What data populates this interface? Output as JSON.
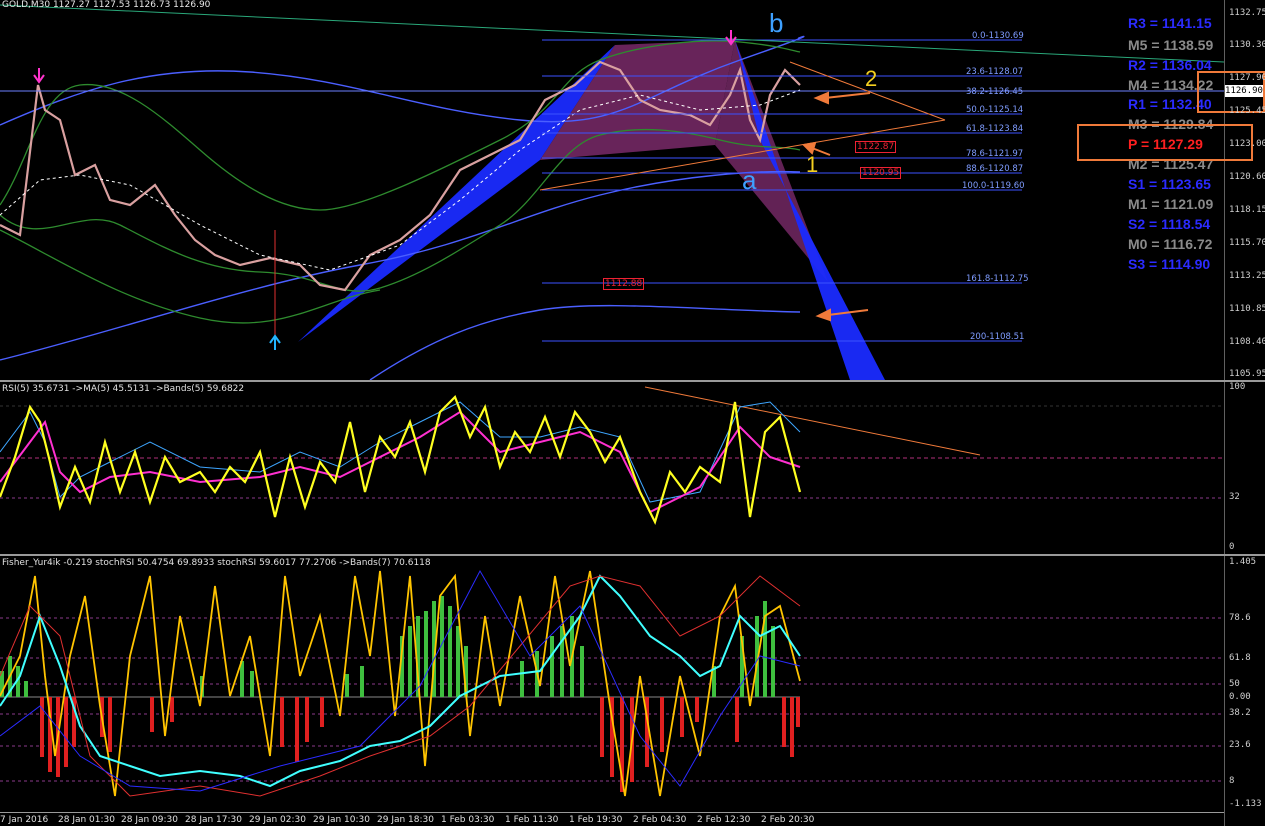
{
  "header": {
    "symbol_line": "GOLD,M30  1127.27 1127.53 1126.73 1126.90"
  },
  "price_scale": {
    "labels": [
      "1132.75",
      "1130.30",
      "1127.90",
      "1125.45",
      "1123.00",
      "1120.60",
      "1118.15",
      "1115.70",
      "1113.25",
      "1110.85",
      "1108.40",
      "1105.95"
    ],
    "current": "1126.90"
  },
  "fibonacci": {
    "levels": [
      "0.0-1130.69",
      "23.6-1128.07",
      "38.2-1126.45",
      "50.0-1125.14",
      "61.8-1123.84",
      "78.6-1121.97",
      "88.6-1120.87",
      "100.0-1119.60",
      "161.8-1112.75",
      "200-1108.51"
    ]
  },
  "price_boxes": [
    "1122.87",
    "1120.95",
    "1112.88"
  ],
  "wave_labels": {
    "a": "a",
    "b": "b",
    "one": "1",
    "two": "2"
  },
  "pivots": [
    {
      "label": "R3 = 1141.15",
      "color": "#2b2bff"
    },
    {
      "label": "M5 = 1138.59",
      "color": "#8a8a8a"
    },
    {
      "label": "R2 = 1136.04",
      "color": "#2b2bff"
    },
    {
      "label": "M4 = 1134.22",
      "color": "#8a8a8a"
    },
    {
      "label": "R1 = 1132.40",
      "color": "#2b2bff"
    },
    {
      "label": "M3 = 1129.84",
      "color": "#8a8a8a"
    },
    {
      "label": "P  = 1127.29",
      "color": "#ff2020"
    },
    {
      "label": "M2 = 1125.47",
      "color": "#8a8a8a"
    },
    {
      "label": "S1 = 1123.65",
      "color": "#2b2bff"
    },
    {
      "label": "M1 = 1121.09",
      "color": "#8a8a8a"
    },
    {
      "label": "S2 = 1118.54",
      "color": "#2b2bff"
    },
    {
      "label": "M0 = 1116.72",
      "color": "#8a8a8a"
    },
    {
      "label": "S3 = 1114.90",
      "color": "#2b2bff"
    }
  ],
  "rsi_pane": {
    "title": "RSI(5) 35.6731  ->MA(5) 45.5131  ->Bands(5) 59.6822",
    "scale": [
      "100",
      "32",
      "0"
    ]
  },
  "fisher_pane": {
    "title": "Fisher_Yur4ik -0.219  stochRSI 50.4754 69.8933  stochRSI 59.6017 77.2706  ->Bands(7) 70.6118",
    "scale": [
      "1.405",
      "78.6",
      "61.8",
      "50",
      "0.00",
      "38.2",
      "23.6",
      "8",
      "-1.133"
    ]
  },
  "time_axis": [
    "7 Jan 2016",
    "28 Jan 01:30",
    "28 Jan 09:30",
    "28 Jan 17:30",
    "29 Jan 02:30",
    "29 Jan 10:30",
    "29 Jan 18:30",
    "1 Feb 03:30",
    "1 Feb 11:30",
    "1 Feb 19:30",
    "2 Feb 04:30",
    "2 Feb 12:30",
    "2 Feb 20:30"
  ],
  "colors": {
    "bull_candle": "#3fbf3f",
    "bear_candle": "#e03030",
    "pattern_blue": "#1a2bff",
    "pattern_purple": "#7a2a6a",
    "rsi_line": "#ffff20",
    "accent_orange": "#f07a3a"
  }
}
